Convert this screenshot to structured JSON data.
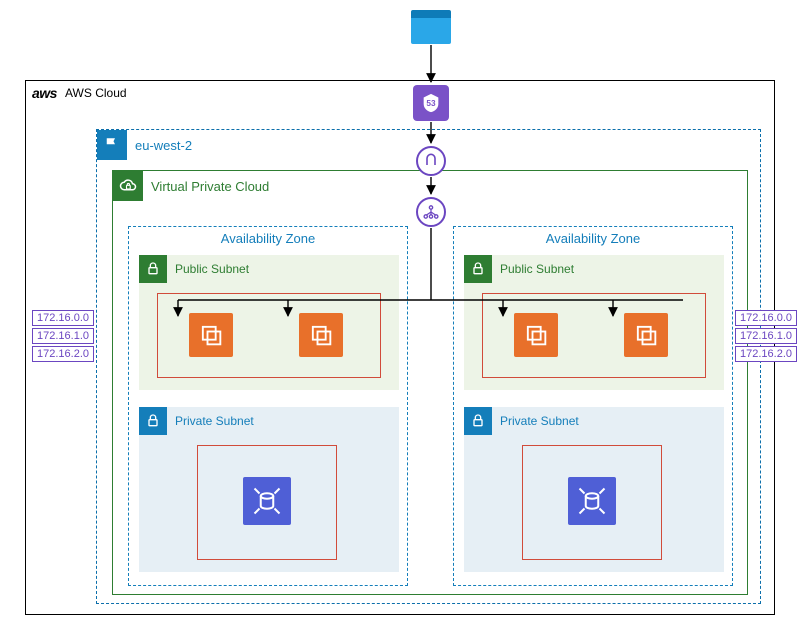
{
  "cloud": {
    "label": "AWS Cloud",
    "logo_text": "aws"
  },
  "region": {
    "label": "eu-west-2"
  },
  "vpc": {
    "label": "Virtual Private Cloud"
  },
  "az": {
    "label": "Availability Zone"
  },
  "public_subnet": {
    "label": "Public Subnet"
  },
  "private_subnet": {
    "label": "Private Subnet"
  },
  "cidrs": {
    "a": "172.16.0.0",
    "b": "172.16.1.0",
    "c": "172.16.2.0"
  },
  "top": {
    "client": "Web Client",
    "route53": "Route 53",
    "igw": "Internet Gateway",
    "elb": "Elastic Load Balancer"
  }
}
